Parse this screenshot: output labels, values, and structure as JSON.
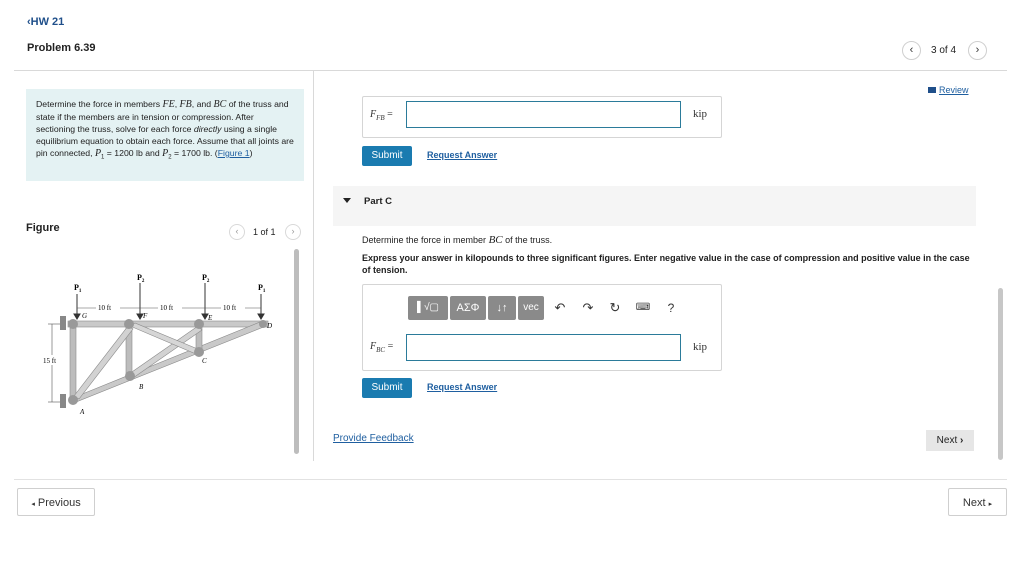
{
  "header": {
    "back_label": "HW 21",
    "problem_title": "Problem 6.39",
    "page_count": "3 of 4",
    "prev_icon": "chevron-left-icon",
    "next_icon": "chevron-right-icon"
  },
  "statement": {
    "line1_pre": "Determine the force in members ",
    "m1": "FE",
    "m2": "FB",
    "m3": "BC",
    "and": ", and ",
    "comma": ", ",
    "line1_post": " of the truss and state if the members are in tension or compression. After sectioning the truss, solve for each force ",
    "directly": "directly",
    "line2": " using a single equilibrium equation to obtain each force. Assume that all joints are pin connected, ",
    "p1_var": "P",
    "p1_sub": "1",
    "p1_val": " = 1200 lb",
    "and2": " and ",
    "p2_var": "P",
    "p2_sub": "2",
    "p2_val": " = 1700 lb",
    "figure_link": "Figure 1"
  },
  "figure": {
    "label": "Figure",
    "count": "1 of 1",
    "labels": {
      "p1": "P",
      "p1s": "1",
      "p2": "P",
      "p2s": "2",
      "dim1": "10 ft",
      "dim2": "10 ft",
      "dim3": "10 ft",
      "height": "15 ft",
      "G": "G",
      "F": "F",
      "E": "E",
      "D": "D",
      "A": "A",
      "B": "B",
      "C": "C"
    }
  },
  "review_link": "Review",
  "partB": {
    "var": "F",
    "sub": "FB",
    "eq": " =",
    "unit": "kip",
    "value": "",
    "submit": "Submit",
    "request": "Request Answer"
  },
  "partC": {
    "title": "Part C",
    "question_pre": "Determine the force in member ",
    "question_member": "BC",
    "question_post": " of the truss.",
    "instructions": "Express your answer in kilopounds to three significant figures. Enter negative value in the case of compression and positive value in the case of tension.",
    "var": "F",
    "sub": "BC",
    "eq": " =",
    "unit": "kip",
    "value": "",
    "submit": "Submit",
    "request": "Request Answer",
    "toolbar": {
      "templates": "▌√▢",
      "greek": "ΑΣΦ",
      "arrows": "↓↑",
      "vec": "vec",
      "undo_icon": "undo-icon",
      "redo_icon": "redo-icon",
      "reset_icon": "reset-icon",
      "keyboard_icon": "keyboard-icon",
      "help": "?"
    }
  },
  "feedback_link": "Provide Feedback",
  "next_small": "Next",
  "footer": {
    "previous": "Previous",
    "next": "Next"
  }
}
